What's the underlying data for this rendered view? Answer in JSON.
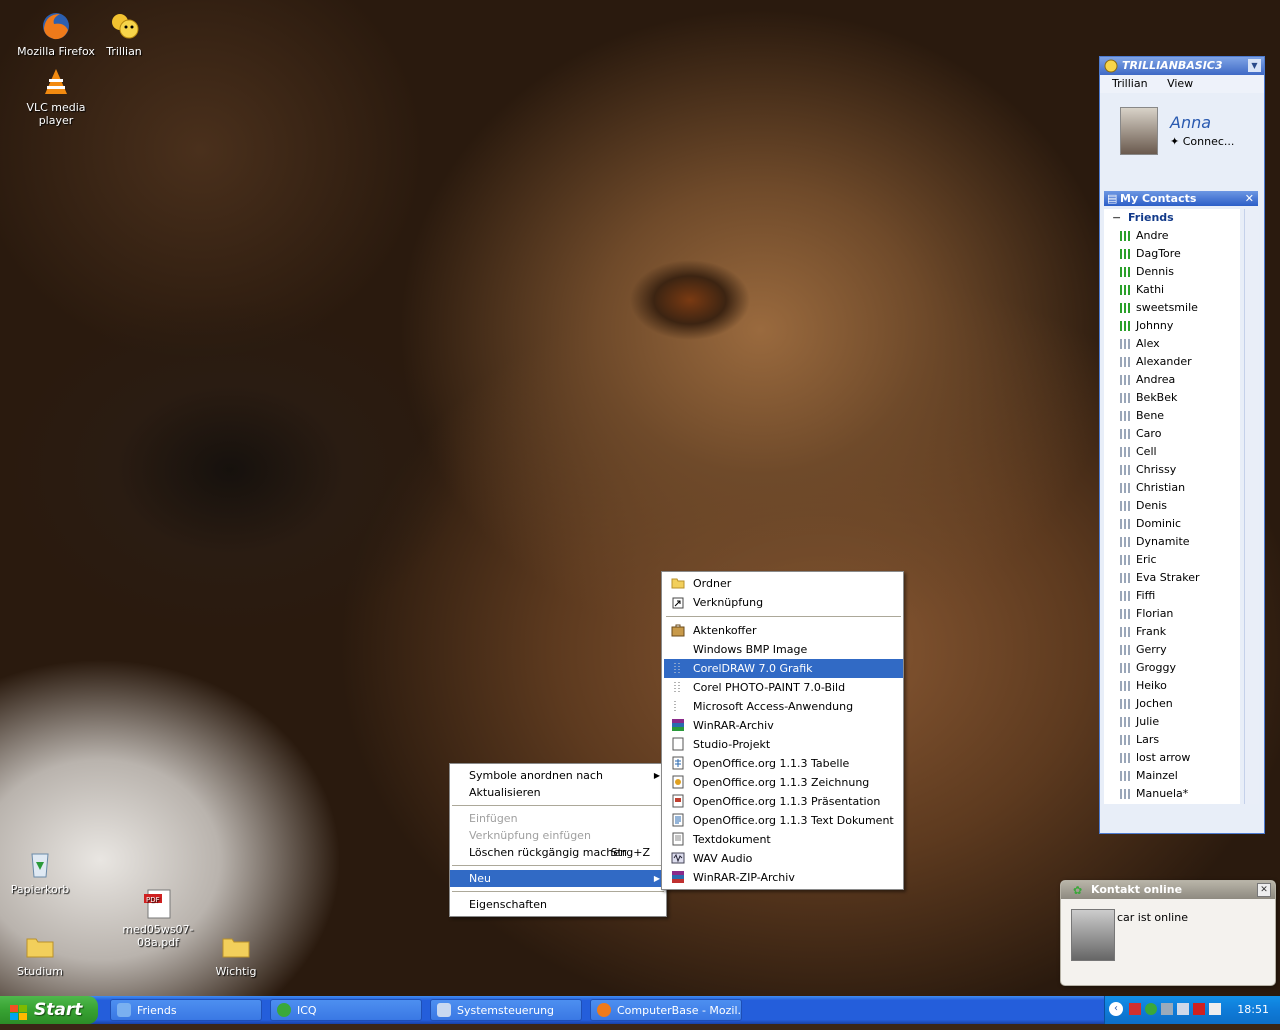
{
  "desktop_icons": [
    {
      "name": "firefox",
      "label": "Mozilla Firefox"
    },
    {
      "name": "trillian",
      "label": "Trillian"
    },
    {
      "name": "vlc",
      "label": "VLC media player"
    },
    {
      "name": "recycle",
      "label": "Papierkorb"
    },
    {
      "name": "pdf",
      "label": "med05ws07-08a.pdf"
    },
    {
      "name": "studium",
      "label": "Studium"
    },
    {
      "name": "wichtig",
      "label": "Wichtig"
    }
  ],
  "context_menu": {
    "items": [
      {
        "label": "Symbole anordnen nach",
        "state": "normal",
        "submenu": true
      },
      {
        "label": "Aktualisieren",
        "state": "normal"
      },
      {
        "label": "Einfügen",
        "state": "disabled"
      },
      {
        "label": "Verknüpfung einfügen",
        "state": "disabled"
      },
      {
        "label": "Löschen rückgängig machen",
        "shortcut": "Strg+Z",
        "state": "normal"
      },
      {
        "label": "Neu",
        "state": "selected",
        "submenu": true
      },
      {
        "label": "Eigenschaften",
        "state": "normal"
      }
    ]
  },
  "submenu_neu": {
    "items": [
      {
        "label": "Ordner",
        "icon": "folder-icon"
      },
      {
        "label": "Verknüpfung",
        "icon": "shortcut-icon"
      },
      {
        "label": "Aktenkoffer",
        "icon": "briefcase-icon"
      },
      {
        "label": "Windows BMP Image",
        "icon": ""
      },
      {
        "label": "CorelDRAW 7.0 Grafik",
        "icon": "corel-icon",
        "selected": true
      },
      {
        "label": "Corel PHOTO-PAINT 7.0-Bild",
        "icon": "corel-icon"
      },
      {
        "label": "Microsoft Access-Anwendung",
        "icon": "access-icon"
      },
      {
        "label": "WinRAR-Archiv",
        "icon": "winrar-icon"
      },
      {
        "label": "Studio-Projekt",
        "icon": "studio-icon"
      },
      {
        "label": "OpenOffice.org 1.1.3 Tabelle",
        "icon": "oo-calc-icon"
      },
      {
        "label": "OpenOffice.org 1.1.3 Zeichnung",
        "icon": "oo-draw-icon"
      },
      {
        "label": "OpenOffice.org 1.1.3 Präsentation",
        "icon": "oo-impress-icon"
      },
      {
        "label": "OpenOffice.org 1.1.3 Text Dokument",
        "icon": "oo-writer-icon"
      },
      {
        "label": "Textdokument",
        "icon": "text-icon"
      },
      {
        "label": "WAV Audio",
        "icon": "wav-icon"
      },
      {
        "label": "WinRAR-ZIP-Archiv",
        "icon": "winrar-zip-icon"
      }
    ]
  },
  "trillian": {
    "brand": "TRILLIANBASIC3",
    "menu": [
      "Trillian",
      "View"
    ],
    "profile_name": "Anna",
    "profile_status": "Connec...",
    "contacts_title": "My Contacts",
    "group": "Friends",
    "online": [
      "Andre",
      "DagTore",
      "Dennis",
      "Kathi",
      "sweetsmile",
      "Johnny"
    ],
    "offline": [
      "Alex",
      "Alexander",
      "Andrea",
      "BekBek",
      "Bene",
      "Caro",
      "Cell",
      "Chrissy",
      "Christian",
      "Denis",
      "Dominic",
      "Dynamite",
      "Eric",
      "Eva Straker",
      "Fiffi",
      "Florian",
      "Frank",
      "Gerry",
      "Groggy",
      "Heiko",
      "Jochen",
      "Julie",
      "Lars",
      "lost arrow",
      "Mainzel",
      "Manuela*"
    ]
  },
  "notification": {
    "title": "Kontakt online",
    "message": "car ist online"
  },
  "taskbar": {
    "start_label": "Start",
    "buttons": [
      {
        "label": "Friends",
        "icon": "trillian-icon"
      },
      {
        "label": "ICQ",
        "icon": "icq-icon"
      },
      {
        "label": "Systemsteuerung",
        "icon": "control-panel-icon"
      },
      {
        "label": "ComputerBase - Mozil...",
        "icon": "firefox-icon"
      }
    ],
    "clock": "18:51"
  },
  "colors": {
    "highlight": "#316ac5",
    "taskbar": "#245edb",
    "start": "#37a232",
    "tray": "#0f7bd8"
  }
}
